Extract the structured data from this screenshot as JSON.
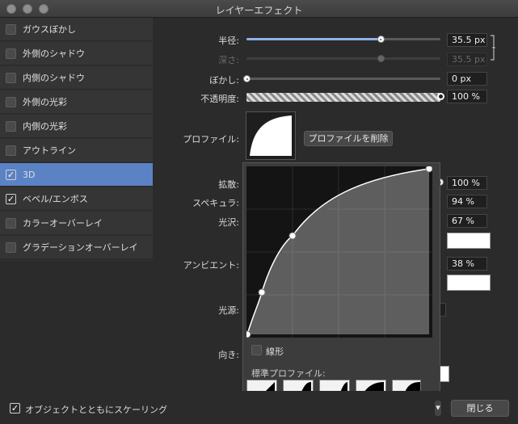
{
  "window": {
    "title": "レイヤーエフェクト"
  },
  "sidebar": {
    "items": [
      {
        "label": "ガウスぼかし",
        "checked": false,
        "selected": false
      },
      {
        "label": "外側のシャドウ",
        "checked": false,
        "selected": false
      },
      {
        "label": "内側のシャドウ",
        "checked": false,
        "selected": false
      },
      {
        "label": "外側の光彩",
        "checked": false,
        "selected": false
      },
      {
        "label": "内側の光彩",
        "checked": false,
        "selected": false
      },
      {
        "label": "アウトライン",
        "checked": false,
        "selected": false
      },
      {
        "label": "3D",
        "checked": true,
        "selected": true
      },
      {
        "label": "ベベル/エンボス",
        "checked": true,
        "selected": false
      },
      {
        "label": "カラーオーバーレイ",
        "checked": false,
        "selected": false
      },
      {
        "label": "グラデーションオーバーレイ",
        "checked": false,
        "selected": false
      }
    ]
  },
  "controls": {
    "radius_label": "半径:",
    "radius_value": "35.5 px",
    "radius_fraction": 0.69,
    "depth_label": "深さ:",
    "depth_value": "35.5 px",
    "depth_fraction": 0.69,
    "blur_label": "ぼかし:",
    "blur_value": "0 px",
    "blur_fraction": 0.0,
    "opacity_label": "不透明度:",
    "opacity_value": "100 %",
    "opacity_fraction": 1.0,
    "profile_label": "プロファイル:",
    "delete_profile_button": "プロファイルを削除",
    "diffuse_label": "拡散:",
    "diffuse_value": "100 %",
    "specular_label": "スペキュラ:",
    "specular_value": "94 %",
    "gloss_label": "光沢:",
    "gloss_value": "67 %",
    "ambient_label": "アンビエント:",
    "ambient_value": "38 %",
    "light_source_label": "光源:",
    "direction_label": "向き:"
  },
  "popover": {
    "linear_label": "線形",
    "linear_checked": false,
    "standard_profiles_label": "標準プロファイル:"
  },
  "footer": {
    "scale_with_object_label": "オブジェクトとともにスケーリング",
    "scale_with_object_checked": true,
    "close_button": "閉じる"
  },
  "colors": {
    "selection": "#5a82c4",
    "slider_fill": "#8fb2e8",
    "background": "#2b2b2b"
  }
}
